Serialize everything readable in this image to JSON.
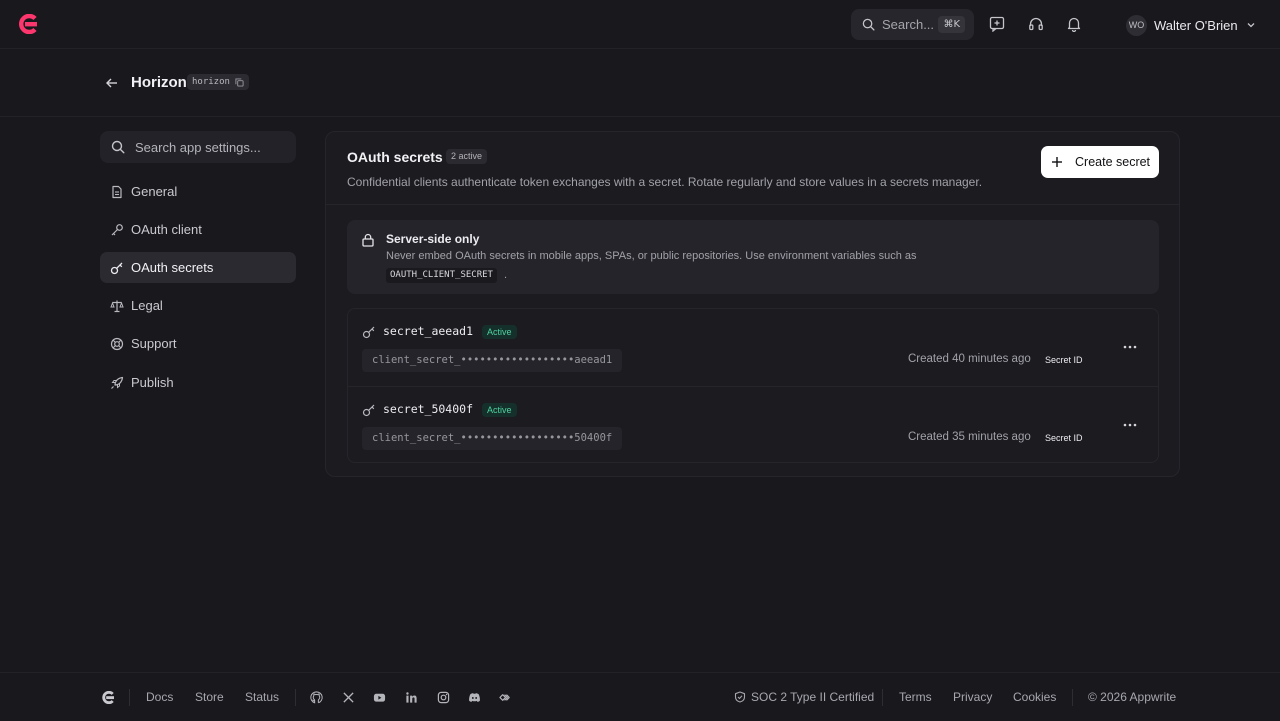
{
  "topbar": {
    "search_label": "Search...",
    "search_shortcut": "⌘K",
    "user_initials": "WO",
    "user_name": "Walter O'Brien",
    "icons": [
      "search-icon",
      "feedback-icon",
      "headset-icon",
      "bell-icon",
      "chevron-down-icon"
    ]
  },
  "header": {
    "title": "Horizon",
    "slug": "horizon"
  },
  "sidebar": {
    "search_placeholder": "Search app settings...",
    "items": [
      {
        "label": "General",
        "icon": "document-icon"
      },
      {
        "label": "OAuth client",
        "icon": "key-icon"
      },
      {
        "label": "OAuth secrets",
        "icon": "key-round-icon",
        "active": true
      },
      {
        "label": "Legal",
        "icon": "scale-icon"
      },
      {
        "label": "Support",
        "icon": "lifebuoy-icon"
      },
      {
        "label": "Publish",
        "icon": "rocket-icon"
      }
    ]
  },
  "main": {
    "title": "OAuth secrets",
    "badge": "2 active",
    "description": "Confidential clients authenticate token exchanges with a secret. Rotate regularly and store values in a secrets manager.",
    "create_label": "Create secret",
    "alert": {
      "title": "Server-side only",
      "text": "Never embed OAuth secrets in mobile apps, SPAs, or public repositories. Use environment variables such as",
      "code": "OAUTH_CLIENT_SECRET",
      "period": "."
    },
    "secrets": [
      {
        "name": "secret_aeead1",
        "status": "Active",
        "value": "client_secret_••••••••••••••••••aeead1",
        "created": "Created 40 minutes ago",
        "id_label": "Secret ID"
      },
      {
        "name": "secret_50400f",
        "status": "Active",
        "value": "client_secret_••••••••••••••••••50400f",
        "created": "Created 35 minutes ago",
        "id_label": "Secret ID"
      }
    ]
  },
  "footer": {
    "links": [
      "Docs",
      "Store",
      "Status"
    ],
    "socials": [
      "github-icon",
      "x-icon",
      "youtube-icon",
      "linkedin-icon",
      "instagram-icon",
      "discord-icon",
      "daily-dev-icon"
    ],
    "cert": "SOC 2 Type II Certified",
    "legal": [
      "Terms",
      "Privacy",
      "Cookies"
    ],
    "copyright": "© 2026 Appwrite"
  },
  "colors": {
    "background": "#19181d",
    "brand": "#fd366e",
    "status_active": "#4fd1a0",
    "card": "#1c1b20"
  }
}
